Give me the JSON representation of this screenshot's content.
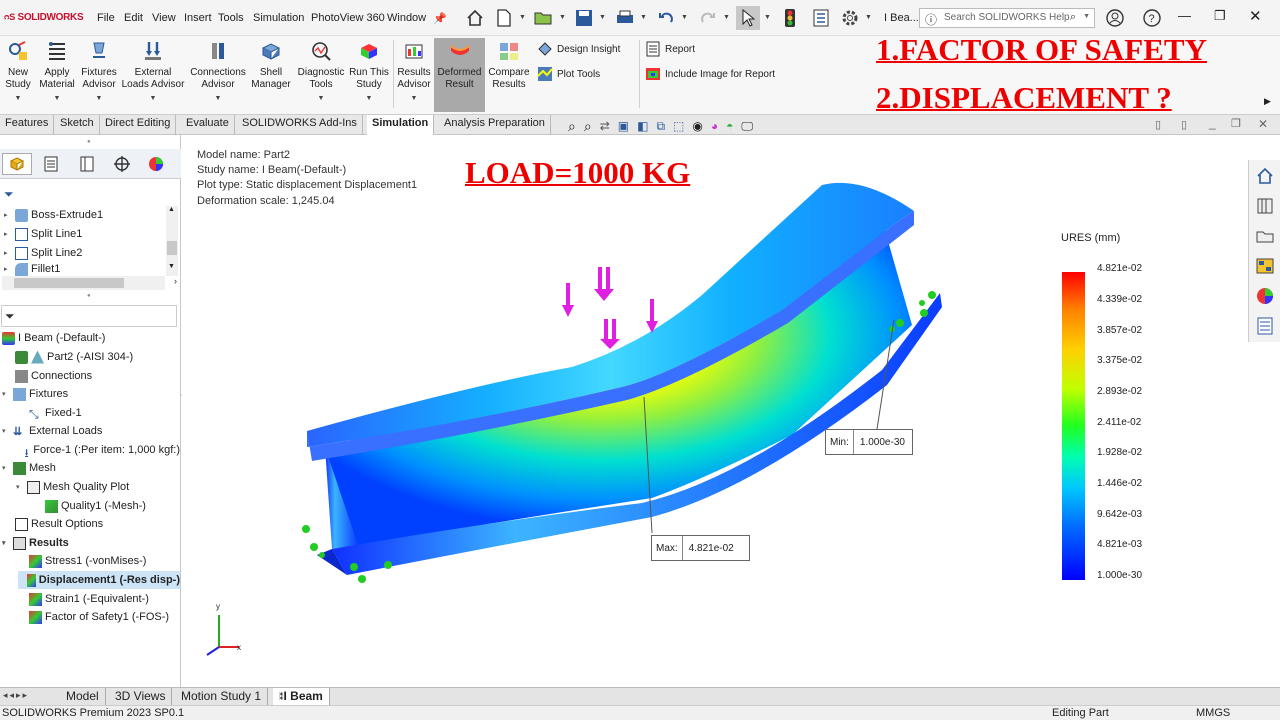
{
  "app": {
    "logo_text": "SOLIDWORKS",
    "doc_name": "I Bea..."
  },
  "menu": [
    "File",
    "Edit",
    "View",
    "Insert",
    "Tools",
    "Simulation",
    "PhotoView 360",
    "Window"
  ],
  "search": {
    "placeholder": "Search SOLIDWORKS Help"
  },
  "ribbon": {
    "buttons": [
      {
        "label": "New\nStudy",
        "icon": "new-study-icon"
      },
      {
        "label": "Apply\nMaterial",
        "icon": "material-icon"
      },
      {
        "label": "Fixtures\nAdvisor",
        "icon": "fixture-icon"
      },
      {
        "label": "External\nLoads Advisor",
        "icon": "load-icon"
      },
      {
        "label": "Connections\nAdvisor",
        "icon": "connection-icon"
      },
      {
        "label": "Shell\nManager",
        "icon": "shell-icon"
      },
      {
        "label": "Diagnostic\nTools",
        "icon": "diagnostic-icon"
      },
      {
        "label": "Run This\nStudy",
        "icon": "run-icon"
      },
      {
        "label": "Results\nAdvisor",
        "icon": "results-icon"
      },
      {
        "label": "Deformed\nResult",
        "icon": "deformed-icon"
      },
      {
        "label": "Compare\nResults",
        "icon": "compare-icon"
      }
    ],
    "small": [
      {
        "label": "Design Insight",
        "icon": "design-insight-icon"
      },
      {
        "label": "Plot Tools",
        "icon": "plot-tools-icon"
      },
      {
        "label": "Report",
        "icon": "report-icon"
      },
      {
        "label": "Include Image for Report",
        "icon": "include-image-icon"
      }
    ]
  },
  "tabs": [
    "Features",
    "Sketch",
    "Direct Editing",
    "Evaluate",
    "SOLIDWORKS Add-Ins",
    "Simulation",
    "Analysis Preparation"
  ],
  "active_tab": "Simulation",
  "tree_top": [
    "Boss-Extrude1",
    "Split Line1",
    "Split Line2",
    "Fillet1"
  ],
  "sim_tree": {
    "study": "I Beam (-Default-)",
    "part": "Part2 (-AISI 304-)",
    "connections": "Connections",
    "fixtures": "Fixtures",
    "fixed": "Fixed-1",
    "external_loads": "External Loads",
    "force": "Force-1 (:Per item: 1,000 kgf:)",
    "mesh": "Mesh",
    "mesh_quality_plot": "Mesh Quality Plot",
    "quality": "Quality1 (-Mesh-)",
    "result_options": "Result Options",
    "results": "Results",
    "stress": "Stress1 (-vonMises-)",
    "displacement": "Displacement1 (-Res disp-)",
    "strain": "Strain1 (-Equivalent-)",
    "fos": "Factor of Safety1 (-FOS-)"
  },
  "plot_info": {
    "model": "Model name: Part2",
    "study": "Study name: I Beam(-Default-)",
    "plot_type": "Plot type: Static displacement Displacement1",
    "scale": "Deformation scale: 1,245.04"
  },
  "overlay": {
    "load": "LOAD=1000 KG",
    "q1": "1.FACTOR OF SAFETY",
    "q2": "2.DISPLACEMENT ?"
  },
  "legend": {
    "title": "URES (mm)",
    "labels": [
      "4.821e-02",
      "4.339e-02",
      "3.857e-02",
      "3.375e-02",
      "2.893e-02",
      "2.411e-02",
      "1.928e-02",
      "1.446e-02",
      "9.642e-03",
      "4.821e-03",
      "1.000e-30"
    ]
  },
  "callouts": {
    "min_label": "Min:",
    "min_value": "1.000e-30",
    "max_label": "Max:",
    "max_value": "4.821e-02"
  },
  "axes": {
    "x": "x",
    "y": "y"
  },
  "bottom_tabs": [
    "Model",
    "3D Views",
    "Motion Study 1",
    "I Beam"
  ],
  "status": {
    "left": "SOLIDWORKS Premium 2023 SP0.1",
    "mode": "Editing Part",
    "units": "MMGS"
  }
}
